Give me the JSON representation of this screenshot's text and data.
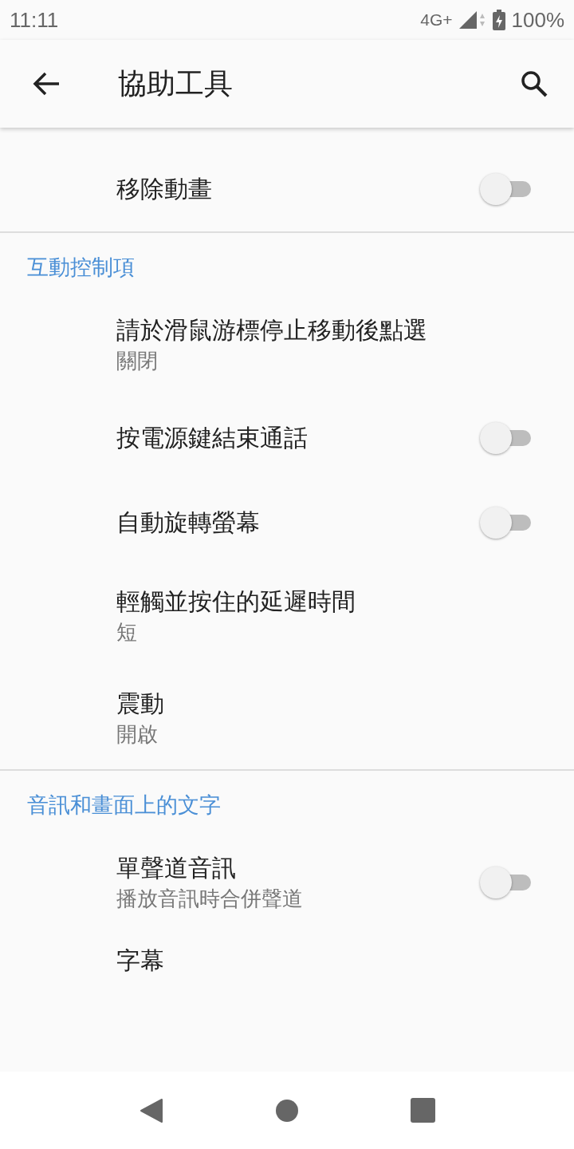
{
  "status_bar": {
    "time": "11:11",
    "network": "4G+",
    "battery": "100%"
  },
  "app_bar": {
    "title": "協助工具"
  },
  "sections": [
    {
      "items": [
        {
          "kind": "toggle",
          "title": "移除動畫",
          "on": false
        }
      ]
    },
    {
      "header": "互動控制項",
      "items": [
        {
          "kind": "text",
          "title": "請於滑鼠游標停止移動後點選",
          "summary": "關閉"
        },
        {
          "kind": "toggle",
          "title": "按電源鍵結束通話",
          "on": false
        },
        {
          "kind": "toggle",
          "title": "自動旋轉螢幕",
          "on": false
        },
        {
          "kind": "text",
          "title": "輕觸並按住的延遲時間",
          "summary": "短"
        },
        {
          "kind": "text",
          "title": "震動",
          "summary": "開啟"
        }
      ]
    },
    {
      "header": "音訊和畫面上的文字",
      "items": [
        {
          "kind": "toggle",
          "title": "單聲道音訊",
          "summary": "播放音訊時合併聲道",
          "on": false
        },
        {
          "kind": "text",
          "title": "字幕"
        }
      ]
    }
  ]
}
